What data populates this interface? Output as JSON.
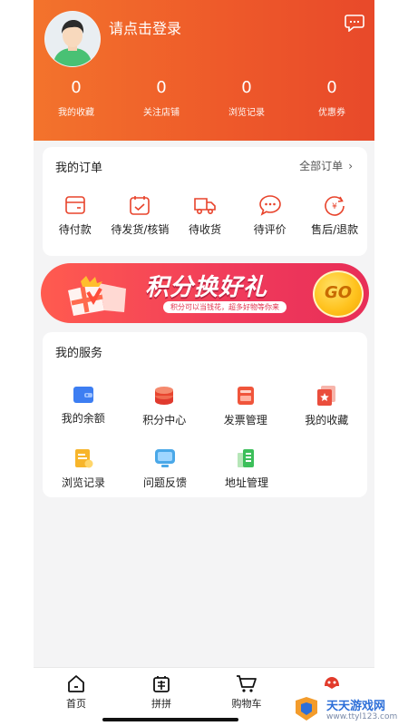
{
  "header": {
    "login_text": "请点击登录",
    "stats": [
      {
        "value": "0",
        "label": "我的收藏"
      },
      {
        "value": "0",
        "label": "关注店铺"
      },
      {
        "value": "0",
        "label": "浏览记录"
      },
      {
        "value": "0",
        "label": "优惠券"
      }
    ]
  },
  "orders": {
    "title": "我的订单",
    "all_label": "全部订单",
    "items": [
      {
        "label": "待付款",
        "icon": "wallet-icon"
      },
      {
        "label": "待发货/核销",
        "icon": "calendar-check-icon"
      },
      {
        "label": "待收货",
        "icon": "truck-icon"
      },
      {
        "label": "待评价",
        "icon": "chat-bubble-icon"
      },
      {
        "label": "售后/退款",
        "icon": "refund-icon"
      }
    ]
  },
  "banner": {
    "title": "积分换好礼",
    "subtitle": "积分可以当钱花，超多好物等你来",
    "go_label": "GO"
  },
  "services": {
    "title": "我的服务",
    "items": [
      {
        "label": "我的余额",
        "icon": "balance-card-icon"
      },
      {
        "label": "积分中心",
        "icon": "coin-stack-icon"
      },
      {
        "label": "发票管理",
        "icon": "invoice-icon"
      },
      {
        "label": "我的收藏",
        "icon": "favorite-star-icon"
      },
      {
        "label": "浏览记录",
        "icon": "history-doc-icon"
      },
      {
        "label": "问题反馈",
        "icon": "feedback-monitor-icon"
      },
      {
        "label": "地址管理",
        "icon": "address-book-icon"
      }
    ]
  },
  "tabbar": [
    {
      "label": "首页",
      "icon": "home-icon"
    },
    {
      "label": "拼拼",
      "icon": "group-buy-icon"
    },
    {
      "label": "购物车",
      "icon": "cart-icon"
    },
    {
      "label": "",
      "icon": "mine-icon"
    }
  ],
  "watermark": {
    "text": "天天游戏网",
    "url": "www.ttyl123.com"
  },
  "colors": {
    "brand_orange": "#ee5a2a",
    "banner_red": "#f03a5b",
    "accent_red": "#e8432b"
  }
}
